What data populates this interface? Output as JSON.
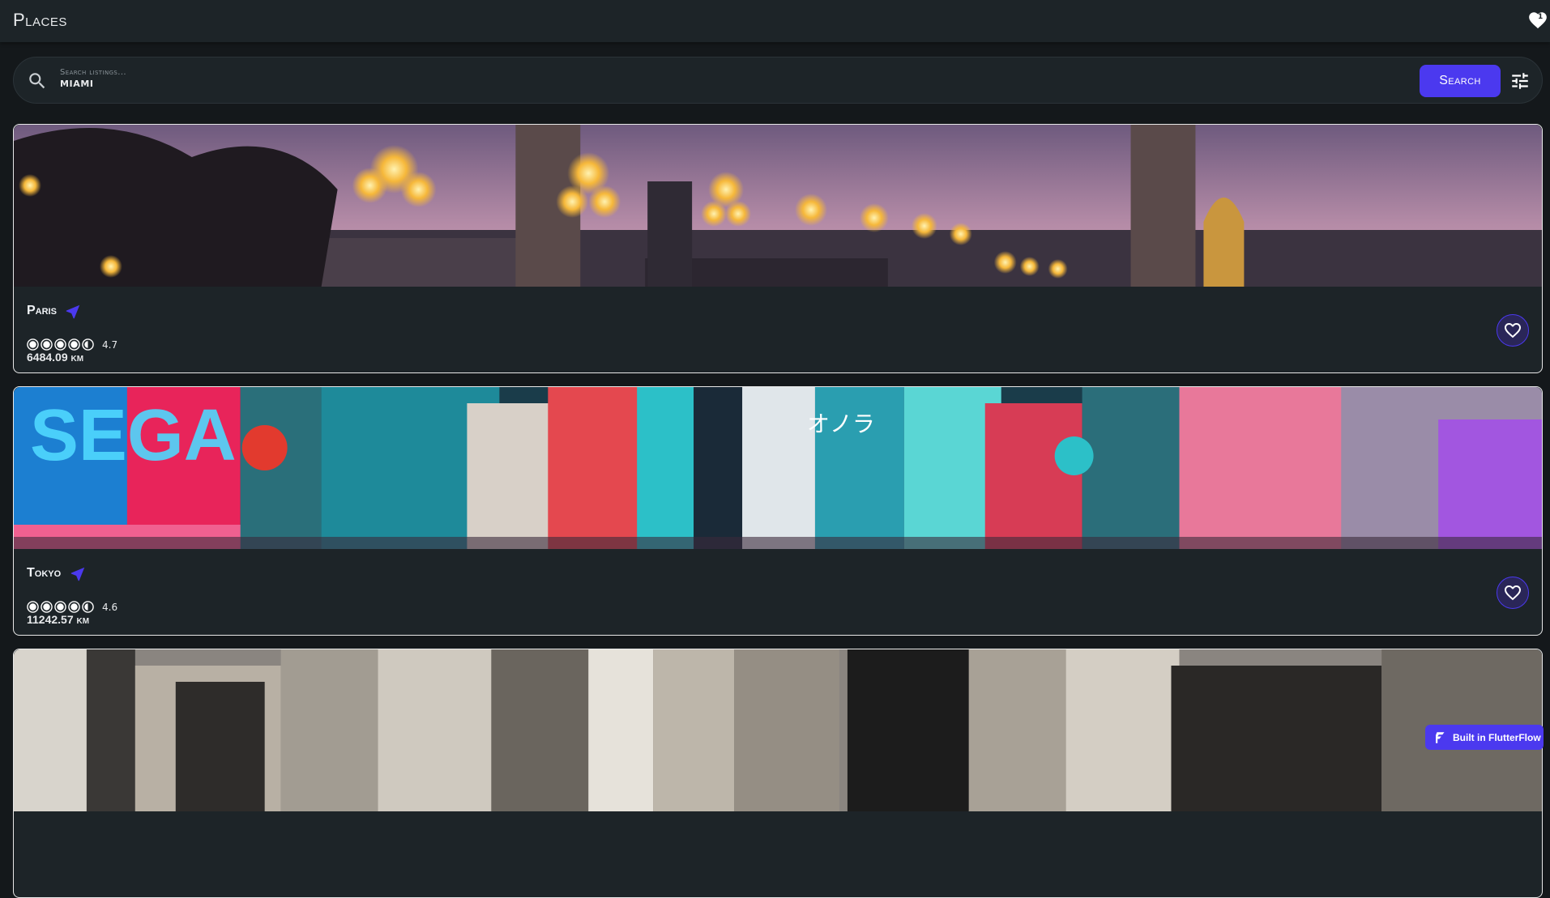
{
  "app": {
    "title": "Places",
    "favorites_icon": "heart-badge-icon"
  },
  "search": {
    "label": "Search listings...",
    "value": "Miami",
    "button_label": "Search",
    "filter_icon": "sliders-icon"
  },
  "listings": [
    {
      "name": "Paris",
      "rating": "4.7",
      "rating_value": 4.7,
      "distance": "6484.09 km"
    },
    {
      "name": "Tokyo",
      "rating": "4.6",
      "rating_value": 4.6,
      "distance": "11242.57 km"
    },
    {
      "name": "",
      "rating": "",
      "distance": ""
    }
  ],
  "badge": {
    "label": "Built in FlutterFlow"
  },
  "colors": {
    "accent": "#4b39ef",
    "background": "#14181b",
    "surface": "#1d2428",
    "text": "#ffffff"
  }
}
